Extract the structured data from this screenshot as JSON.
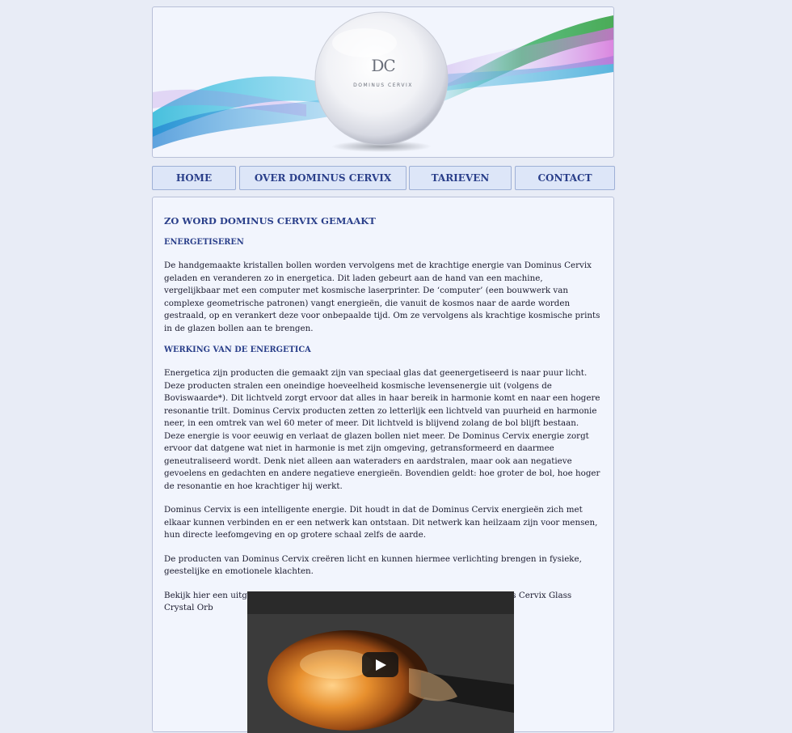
{
  "header": {
    "logo_monogram": "DC",
    "logo_name": "DOMINUS CERVIX"
  },
  "nav": {
    "items": [
      "HOME",
      "OVER DOMINUS CERVIX",
      "TARIEVEN",
      "CONTACT"
    ]
  },
  "content": {
    "title": "ZO WORD DOMINUS CERVIX GEMAAKT",
    "section1_heading": "ENERGETISEREN",
    "section1_paragraph": "De handgemaakte kristallen bollen worden vervolgens met de krachtige energie van Dominus Cervix geladen en veranderen zo in energetica. Dit laden gebeurt aan de hand van een machine, vergelijkbaar met een computer met kosmische laserprinter. De ‘computer’ (een bouwwerk van complexe geometrische patronen) vangt energieën, die vanuit de kosmos naar de aarde worden gestraald, op en verankert deze voor onbepaalde tijd. Om ze vervolgens als krachtige kosmische prints in de glazen bollen aan te brengen.",
    "section2_heading": "WERKING VAN DE ENERGETICA",
    "section2_paragraph1": "Energetica zijn producten die gemaakt zijn van speciaal glas dat geenergetiseerd is naar puur licht. Deze producten stralen een oneindige hoeveelheid kosmische levensenergie uit (volgens de Boviswaarde*). Dit lichtveld zorgt ervoor dat alles in haar bereik in harmonie komt en naar een hogere resonantie trilt. Dominus Cervix producten zetten zo letterlijk een lichtveld van puurheid en harmonie neer, in een omtrek van wel 60 meter of meer. Dit lichtveld is blijvend zolang de bol blijft bestaan. Deze energie is voor eeuwig en verlaat de glazen bollen niet meer. De Dominus Cervix energie zorgt ervoor dat datgene wat niet in harmonie is met zijn omgeving, getransformeerd en daarmee geneutraliseerd wordt. Denk niet alleen aan wateraders en aardstralen, maar ook aan negatieve gevoelens en gedachten en andere negatieve energieën. Bovendien geldt: hoe groter de bol, hoe hoger de resonantie en hoe krachtiger hij werkt.",
    "section2_paragraph2": "Dominus Cervix is een intelligente energie. Dit houdt in dat de Dominus Cervix energieën zich met elkaar kunnen verbinden en er een netwerk kan ontstaan. Dit netwerk kan heilzaam zijn voor mensen, hun directe leefomgeving en op grotere schaal zelfs de aarde.",
    "section2_paragraph3": "De producten van Dominus Cervix creëren licht en kunnen hiermee verlichting brengen in fysieke, geestelijke en emotionele klachten.",
    "video_intro": "Bekijk hier een uitgebreide video (7:55) over de tot stand koming van een Dominus Cervix Glass Crystal Orb"
  },
  "colors": {
    "page_bg": "#e8ecf6",
    "panel_bg": "#f2f5fd",
    "accent": "#2a3f8a",
    "nav_bg": "#dde6f8"
  },
  "icons": {
    "video_play": "play-icon"
  }
}
